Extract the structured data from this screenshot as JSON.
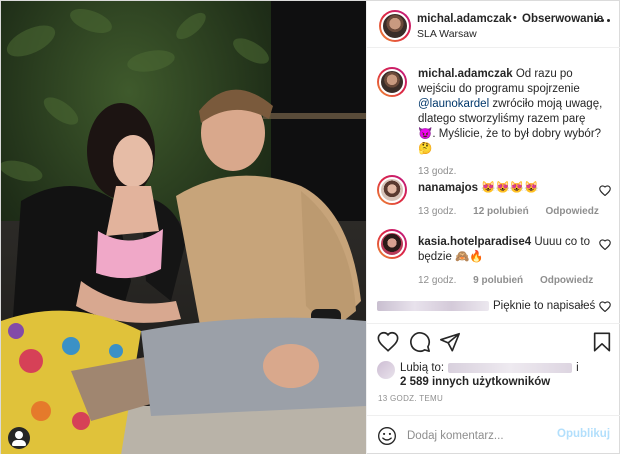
{
  "header": {
    "username": "michal.adamczak",
    "separator": "•",
    "follow_label": "Obserwowanie",
    "location": "SLA Warsaw"
  },
  "caption": {
    "username": "michal.adamczak",
    "text_before": "Od razu po wejściu do programu spojrzenie",
    "mention": "@launokardel",
    "text_after": "zwróciło moją uwagę, dlatego stworzyliśmy razem parę 😈. Myślicie, że to był dobry wybór?🤔",
    "time": "13 godz."
  },
  "comments": [
    {
      "username": "nanamajos",
      "text": "😻😻😻😻",
      "time": "13 godz.",
      "likes": "12 polubień",
      "reply_label": "Odpowiedz"
    },
    {
      "username": "kasia.hotelparadise4",
      "text": "Uuuu co to będzie 🙈🔥",
      "time": "12 godz.",
      "likes": "9 polubień",
      "reply_label": "Odpowiedz"
    },
    {
      "username": "",
      "text": "Pięknie to napisałeś"
    }
  ],
  "likes": {
    "prefix": "Lubią to:",
    "suffix": "i",
    "others": "2 589 innych użytkowników"
  },
  "timestamp": "13 godz. temu",
  "add_comment": {
    "placeholder": "Dodaj komentarz...",
    "post_label": "Opublikuj"
  },
  "icons": {
    "like": "heart-icon",
    "comment": "comment-icon",
    "share": "paper-plane-icon",
    "save": "bookmark-icon",
    "emoji": "smiley-icon",
    "more": "more-options-icon",
    "user_tag": "user-tag-icon"
  },
  "colors": {
    "text": "#262626",
    "secondary": "#8e8e8e",
    "mention": "#00376b",
    "post_button_disabled": "#b2dffc",
    "divider": "#efefef"
  }
}
